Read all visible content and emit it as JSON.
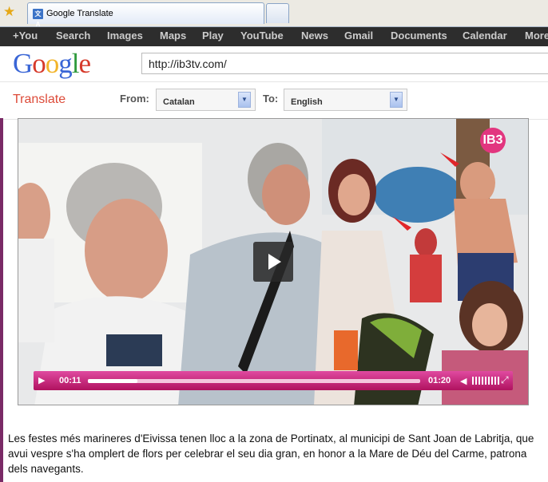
{
  "browser": {
    "tab_title": "Google Translate",
    "tab_icon": "translate-icon",
    "bookmark_icon": "star-icon"
  },
  "gbar": {
    "items": [
      "+You",
      "Search",
      "Images",
      "Maps",
      "Play",
      "YouTube",
      "News",
      "Gmail",
      "Documents",
      "Calendar",
      "More"
    ]
  },
  "header": {
    "logo_text": "Google",
    "url_value": "http://ib3tv.com/"
  },
  "translate": {
    "title": "Translate",
    "from_label": "From:",
    "from_value": "Catalan",
    "to_label": "To:",
    "to_value": "English"
  },
  "video": {
    "channel_logo": "IB3",
    "current_time": "00:11",
    "duration": "01:20",
    "progress": 0.15
  },
  "caption": {
    "text": "Les festes més marineres d'Eivissa tenen lloc a la zona de Portinatx, al municipi de Sant Joan de Labritja, que avui vespre s'ha omplert de flors per celebrar el seu dia gran, en honor a la Mare de Déu del Carme, patrona dels navegants."
  },
  "colors": {
    "accent": "#dd4b39",
    "player": "#c2186f",
    "gbar": "#2d2d2d"
  }
}
